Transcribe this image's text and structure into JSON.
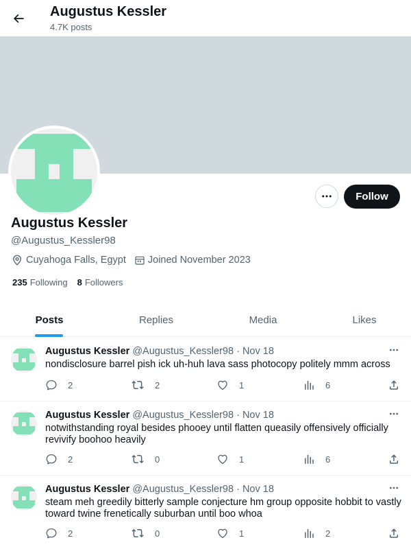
{
  "header": {
    "title": "Augustus Kessler",
    "posts_count": "4.7K posts",
    "back_icon": "arrow-left-icon"
  },
  "colors": {
    "banner": "#cfd9de",
    "avatar_green": "#84e0b6",
    "avatar_bg": "#f0f0f0",
    "follow_button_bg": "#0f1419",
    "accent_blue": "#1d9bf0"
  },
  "profile": {
    "name": "Augustus Kessler",
    "handle": "@Augustus_Kessler98",
    "location": "Cuyahoga Falls, Egypt",
    "joined": "Joined November 2023",
    "following_count": "235",
    "following_label": "Following",
    "followers_count": "8",
    "followers_label": "Followers",
    "follow_button": "Follow"
  },
  "tabs": [
    {
      "label": "Posts",
      "active": true
    },
    {
      "label": "Replies",
      "active": false
    },
    {
      "label": "Media",
      "active": false
    },
    {
      "label": "Likes",
      "active": false
    }
  ],
  "posts": [
    {
      "name": "Augustus Kessler",
      "handle": "@Augustus_Kessler98",
      "dot": "·",
      "date": "Nov 18",
      "text": "nondisclosure barrel pish ick uh-huh lava sass photocopy politely mmm across",
      "replies": "2",
      "reposts": "2",
      "likes": "1",
      "views": "6"
    },
    {
      "name": "Augustus Kessler",
      "handle": "@Augustus_Kessler98",
      "dot": "·",
      "date": "Nov 18",
      "text": "notwithstanding royal besides phooey until flatten queasily offensively officially revivify boohoo heavily",
      "replies": "2",
      "reposts": "0",
      "likes": "1",
      "views": "6"
    },
    {
      "name": "Augustus Kessler",
      "handle": "@Augustus_Kessler98",
      "dot": "·",
      "date": "Nov 18",
      "text": "steam meh greedily bitterly sample conjecture hm group opposite hobbit to vastly toward twine frenetically suburban until boo whoa",
      "replies": "2",
      "reposts": "0",
      "likes": "1",
      "views": "2"
    }
  ]
}
